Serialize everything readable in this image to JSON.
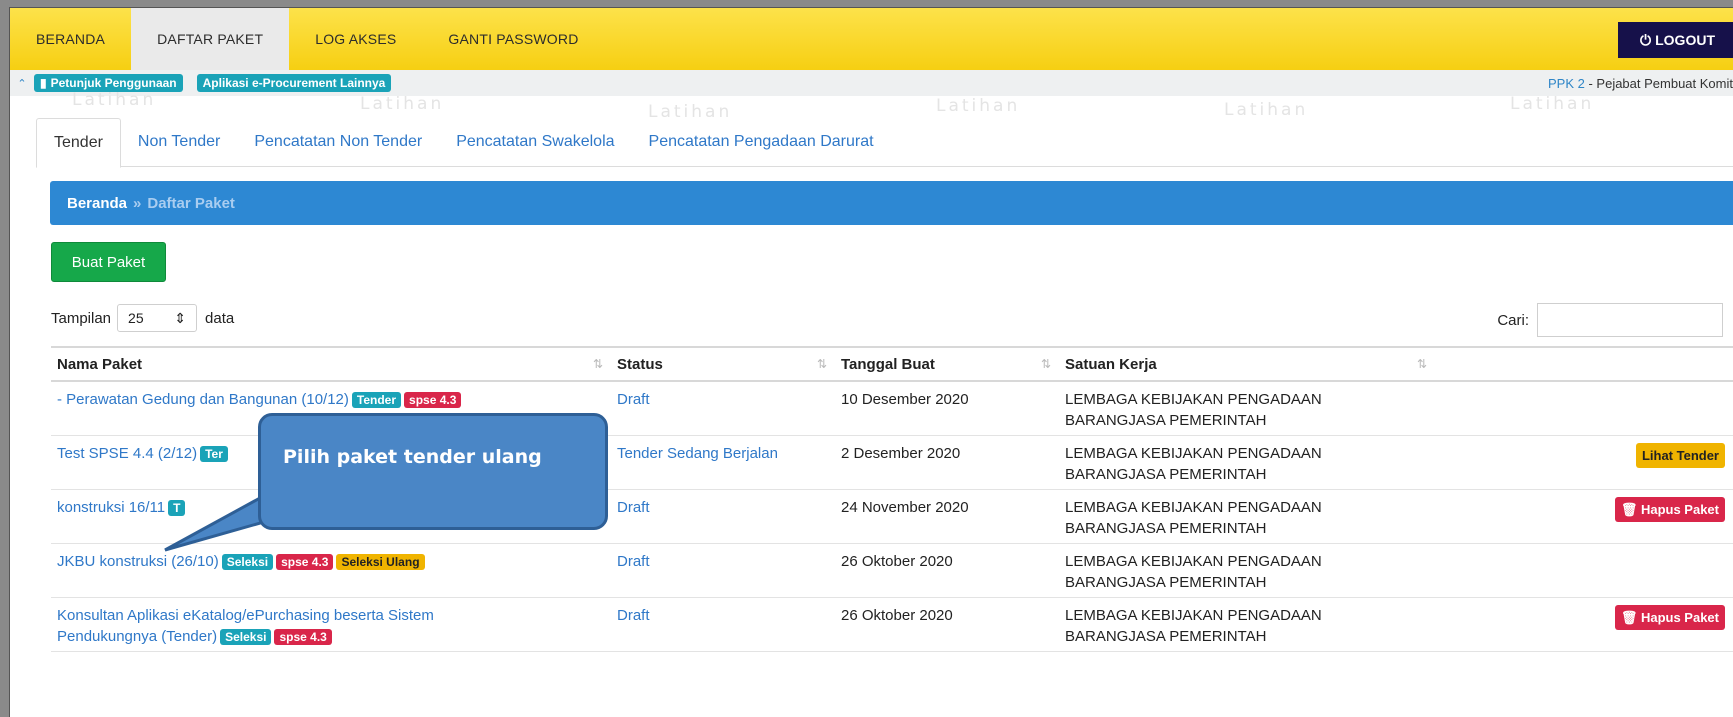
{
  "nav": {
    "items": [
      {
        "label": "BERANDA",
        "active": false
      },
      {
        "label": "DAFTAR PAKET",
        "active": true
      },
      {
        "label": "LOG AKSES",
        "active": false
      },
      {
        "label": "GANTI PASSWORD",
        "active": false
      }
    ],
    "logout_label": "LOGOUT",
    "logout_icon": "power-icon"
  },
  "subbar": {
    "petunjuk": "Petunjuk Penggunaan",
    "aplikasi": "Aplikasi e-Procurement Lainnya",
    "user_role": "PPK 2",
    "user_title": " - Pejabat Pembuat Komit"
  },
  "watermark": "Latihan",
  "tabs": [
    "Tender",
    "Non Tender",
    "Pencatatan Non Tender",
    "Pencatatan Swakelola",
    "Pencatatan Pengadaan Darurat"
  ],
  "breadcrumb": {
    "home": "Beranda",
    "separator": "»",
    "current": "Daftar Paket"
  },
  "buat_paket": "Buat Paket",
  "length": {
    "prefix": "Tampilan",
    "value": "25",
    "suffix": "data"
  },
  "search_label": "Cari:",
  "table": {
    "headers": [
      "Nama Paket",
      "Status",
      "Tanggal Buat",
      "Satuan Kerja"
    ],
    "rows": [
      {
        "nama": "- Perawatan Gedung dan Bangunan (10/12)",
        "tags": [
          "Tender",
          "spse 4.3"
        ],
        "status": "Draft",
        "tanggal": "10 Desember 2020",
        "satker1": "LEMBAGA KEBIJAKAN PENGADAAN",
        "satker2": "BARANGJASA PEMERINTAH",
        "action": ""
      },
      {
        "nama": "Test SPSE 4.4 (2/12)",
        "tags": [
          "Ter"
        ],
        "status": "Tender Sedang Berjalan",
        "tanggal": "2 Desember 2020",
        "satker1": "LEMBAGA KEBIJAKAN PENGADAAN",
        "satker2": "BARANGJASA PEMERINTAH",
        "action": "Lihat Tender"
      },
      {
        "nama": "konstruksi 16/11",
        "tags": [
          "T"
        ],
        "status": "Draft",
        "tanggal": "24 November 2020",
        "satker1": "LEMBAGA KEBIJAKAN PENGADAAN",
        "satker2": "BARANGJASA PEMERINTAH",
        "action": "Hapus Paket"
      },
      {
        "nama": "JKBU konstruksi (26/10)",
        "tags": [
          "Seleksi",
          "spse 4.3",
          "Seleksi Ulang"
        ],
        "status": "Draft",
        "tanggal": "26 Oktober 2020",
        "satker1": "LEMBAGA KEBIJAKAN PENGADAAN",
        "satker2": "BARANGJASA PEMERINTAH",
        "action": ""
      },
      {
        "nama": "Konsultan Aplikasi eKatalog/ePurchasing beserta Sistem",
        "nama2": "Pendukungnya (Tender)",
        "tags": [
          "Seleksi",
          "spse 4.3"
        ],
        "status": "Draft",
        "tanggal": "26 Oktober 2020",
        "satker1": "LEMBAGA KEBIJAKAN PENGADAAN",
        "satker2": "BARANGJASA PEMERINTAH",
        "action": "Hapus Paket"
      }
    ]
  },
  "callout": "Pilih paket tender ulang",
  "colors": {
    "nav": "#f6cf12",
    "logout": "#16114a",
    "crumb": "#2d88d3",
    "btn": "#16a84a",
    "tag_teal": "#1aa3b8",
    "tag_red": "#d9264a",
    "tag_yellow": "#f0b400",
    "callout": "#4a86c6"
  }
}
